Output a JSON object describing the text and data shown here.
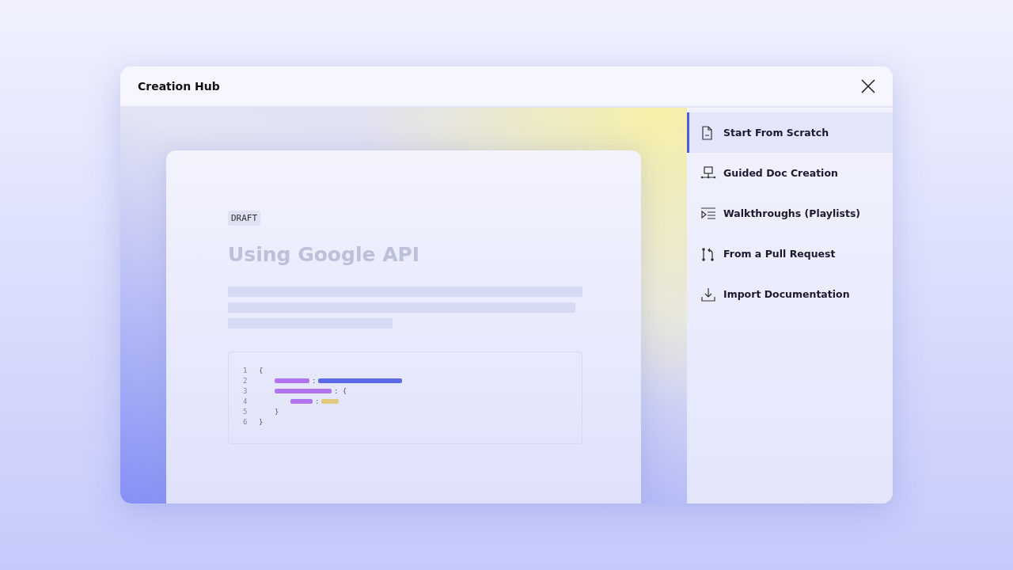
{
  "window": {
    "title": "Creation Hub"
  },
  "preview": {
    "badge": "DRAFT",
    "title": "Using Google API",
    "code_lines": [
      {
        "number": "1",
        "tokens": [
          {
            "kind": "punct",
            "text": "{"
          }
        ]
      },
      {
        "number": "2",
        "tokens": [
          {
            "kind": "key"
          },
          {
            "kind": "punct",
            "text": ":"
          },
          {
            "kind": "string"
          }
        ]
      },
      {
        "number": "3",
        "tokens": [
          {
            "kind": "key"
          },
          {
            "kind": "punct",
            "text": ": {"
          }
        ]
      },
      {
        "number": "4",
        "tokens": [
          {
            "kind": "key"
          },
          {
            "kind": "punct",
            "text": ":"
          },
          {
            "kind": "number"
          }
        ]
      },
      {
        "number": "5",
        "tokens": [
          {
            "kind": "punct",
            "text": "}"
          }
        ]
      },
      {
        "number": "6",
        "tokens": [
          {
            "kind": "punct",
            "text": "}"
          }
        ]
      }
    ]
  },
  "menu": {
    "items": [
      {
        "kind": "document",
        "label": "Start From Scratch",
        "selected": true
      },
      {
        "kind": "flow",
        "label": "Guided Doc Creation",
        "selected": false
      },
      {
        "kind": "playlist",
        "label": "Walkthroughs (Playlists)",
        "selected": false
      },
      {
        "kind": "pull",
        "label": "From a Pull Request",
        "selected": false
      },
      {
        "kind": "import",
        "label": "Import Documentation",
        "selected": false
      }
    ]
  }
}
